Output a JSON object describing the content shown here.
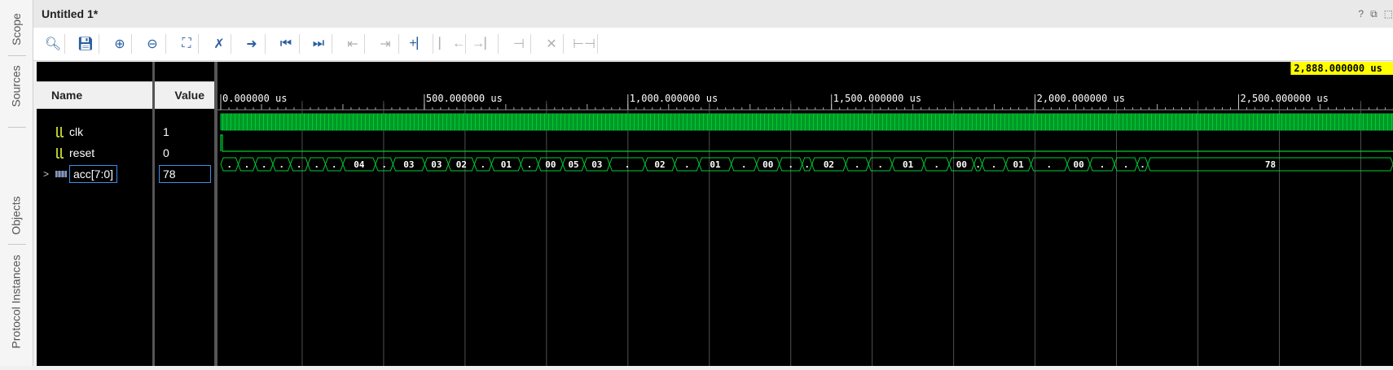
{
  "window": {
    "title": "Untitled 1*",
    "icons": [
      "help-icon",
      "restore-icon",
      "maximize-icon"
    ],
    "help_glyph": "?",
    "restore_glyph": "⧉",
    "maximize_glyph": "⬚"
  },
  "side_tabs": [
    "Scope",
    "Sources",
    "Objects",
    "Protocol Instances"
  ],
  "toolbar": {
    "buttons": [
      {
        "name": "search-icon",
        "glyph": "🔍︎",
        "enabled": true
      },
      {
        "name": "save-icon",
        "glyph": "💾︎",
        "enabled": true
      },
      {
        "name": "zoom-in-icon",
        "glyph": "⊕",
        "enabled": true
      },
      {
        "name": "zoom-out-icon",
        "glyph": "⊖",
        "enabled": true
      },
      {
        "name": "zoom-fit-icon",
        "glyph": "⛶",
        "enabled": true
      },
      {
        "name": "cursor-icon",
        "glyph": "✗",
        "enabled": true
      },
      {
        "name": "goto-cursor-icon",
        "glyph": "➜",
        "enabled": true
      },
      {
        "name": "goto-start-icon",
        "glyph": "⏮",
        "enabled": true
      },
      {
        "name": "goto-end-icon",
        "glyph": "⏭",
        "enabled": true
      },
      {
        "name": "prev-transition-icon",
        "glyph": "⇤",
        "enabled": false
      },
      {
        "name": "next-transition-icon",
        "glyph": "⇥",
        "enabled": false
      },
      {
        "name": "add-marker-icon",
        "glyph": "+⎸",
        "enabled": true
      },
      {
        "name": "prev-marker-icon",
        "glyph": "⎸←",
        "enabled": false
      },
      {
        "name": "next-marker-icon",
        "glyph": "→⎸",
        "enabled": false
      },
      {
        "name": "swap-cursors-icon",
        "glyph": "⊣",
        "enabled": false
      },
      {
        "name": "delete-marker-icon",
        "glyph": "✕",
        "enabled": false
      },
      {
        "name": "snap-icon",
        "glyph": "⊢⊣",
        "enabled": false
      }
    ]
  },
  "columns": {
    "name": "Name",
    "value": "Value"
  },
  "signals": [
    {
      "name": "clk",
      "value": "1",
      "icon": "bit-signal-icon"
    },
    {
      "name": "reset",
      "value": "0",
      "icon": "bit-signal-icon"
    },
    {
      "name": "acc[7:0]",
      "value": "78",
      "icon": "bus-signal-icon",
      "expandable": true,
      "expand_glyph": ">"
    }
  ],
  "waveform": {
    "cursor_label": "2,888.000000 us",
    "ruler_labels": [
      "0.000000 us",
      "500.000000 us",
      "1,000.000000 us",
      "1,500.000000 us",
      "2,000.000000 us",
      "2,500.000000 us"
    ],
    "ruler_values_us": [
      0,
      500,
      1000,
      1500,
      2000,
      2500
    ],
    "cursor_us": 2888,
    "bus_labels": [
      {
        "t_us": 0,
        "label": "."
      },
      {
        "t_us": 43,
        "label": "."
      },
      {
        "t_us": 85,
        "label": "."
      },
      {
        "t_us": 128,
        "label": "."
      },
      {
        "t_us": 171,
        "label": "."
      },
      {
        "t_us": 214,
        "label": "."
      },
      {
        "t_us": 257,
        "label": "."
      },
      {
        "t_us": 300,
        "label": "04"
      },
      {
        "t_us": 380,
        "label": "."
      },
      {
        "t_us": 423,
        "label": "03"
      },
      {
        "t_us": 501,
        "label": "03"
      },
      {
        "t_us": 559,
        "label": "02"
      },
      {
        "t_us": 623,
        "label": "."
      },
      {
        "t_us": 665,
        "label": "01"
      },
      {
        "t_us": 737,
        "label": "."
      },
      {
        "t_us": 780,
        "label": "00"
      },
      {
        "t_us": 840,
        "label": "05"
      },
      {
        "t_us": 893,
        "label": "03"
      },
      {
        "t_us": 955,
        "label": "."
      },
      {
        "t_us": 1042,
        "label": "02"
      },
      {
        "t_us": 1115,
        "label": "."
      },
      {
        "t_us": 1175,
        "label": "01"
      },
      {
        "t_us": 1254,
        "label": "."
      },
      {
        "t_us": 1316,
        "label": "00"
      },
      {
        "t_us": 1372,
        "label": "."
      },
      {
        "t_us": 1428,
        "label": "."
      },
      {
        "t_us": 1452,
        "label": "02"
      },
      {
        "t_us": 1535,
        "label": "."
      },
      {
        "t_us": 1591,
        "label": "."
      },
      {
        "t_us": 1649,
        "label": "01"
      },
      {
        "t_us": 1727,
        "label": "."
      },
      {
        "t_us": 1789,
        "label": "00"
      },
      {
        "t_us": 1850,
        "label": "."
      },
      {
        "t_us": 1870,
        "label": "."
      },
      {
        "t_us": 1928,
        "label": "01"
      },
      {
        "t_us": 1990,
        "label": "."
      },
      {
        "t_us": 2079,
        "label": "00"
      },
      {
        "t_us": 2135,
        "label": "."
      },
      {
        "t_us": 2195,
        "label": "."
      },
      {
        "t_us": 2251,
        "label": "."
      },
      {
        "t_us": 2277,
        "label": "78"
      }
    ],
    "colors": {
      "bg": "#000000",
      "wave": "#00cc33",
      "grid": "#505050",
      "text": "#ffffff",
      "cursor_label_bg": "#ffff00",
      "cursor": "#ffff00"
    }
  }
}
